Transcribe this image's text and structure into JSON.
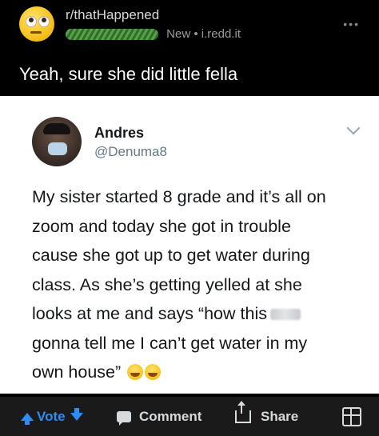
{
  "post": {
    "subreddit": "r/thatHappened",
    "time_label": "New",
    "domain": "i.redd.it",
    "separator": "•",
    "more": "•••",
    "title": "Yeah, sure she did little fella"
  },
  "tweet": {
    "name": "Andres",
    "handle": "@Denuma8",
    "lines": [
      "My sister started 8 grade and it’s all on",
      "zoom and today she got in trouble",
      "cause she got up to get water during",
      "class.  As she’s getting yelled at she",
      "looks at me and says “how this",
      "gonna tell me I can’t get water in my",
      "own house”"
    ]
  },
  "actions": {
    "vote": "Vote",
    "comment": "Comment",
    "share": "Share"
  },
  "colors": {
    "vote_blue": "#2f8cf2",
    "action_bar": "#1a1a1b",
    "tweet_bg": "#ffffff"
  }
}
